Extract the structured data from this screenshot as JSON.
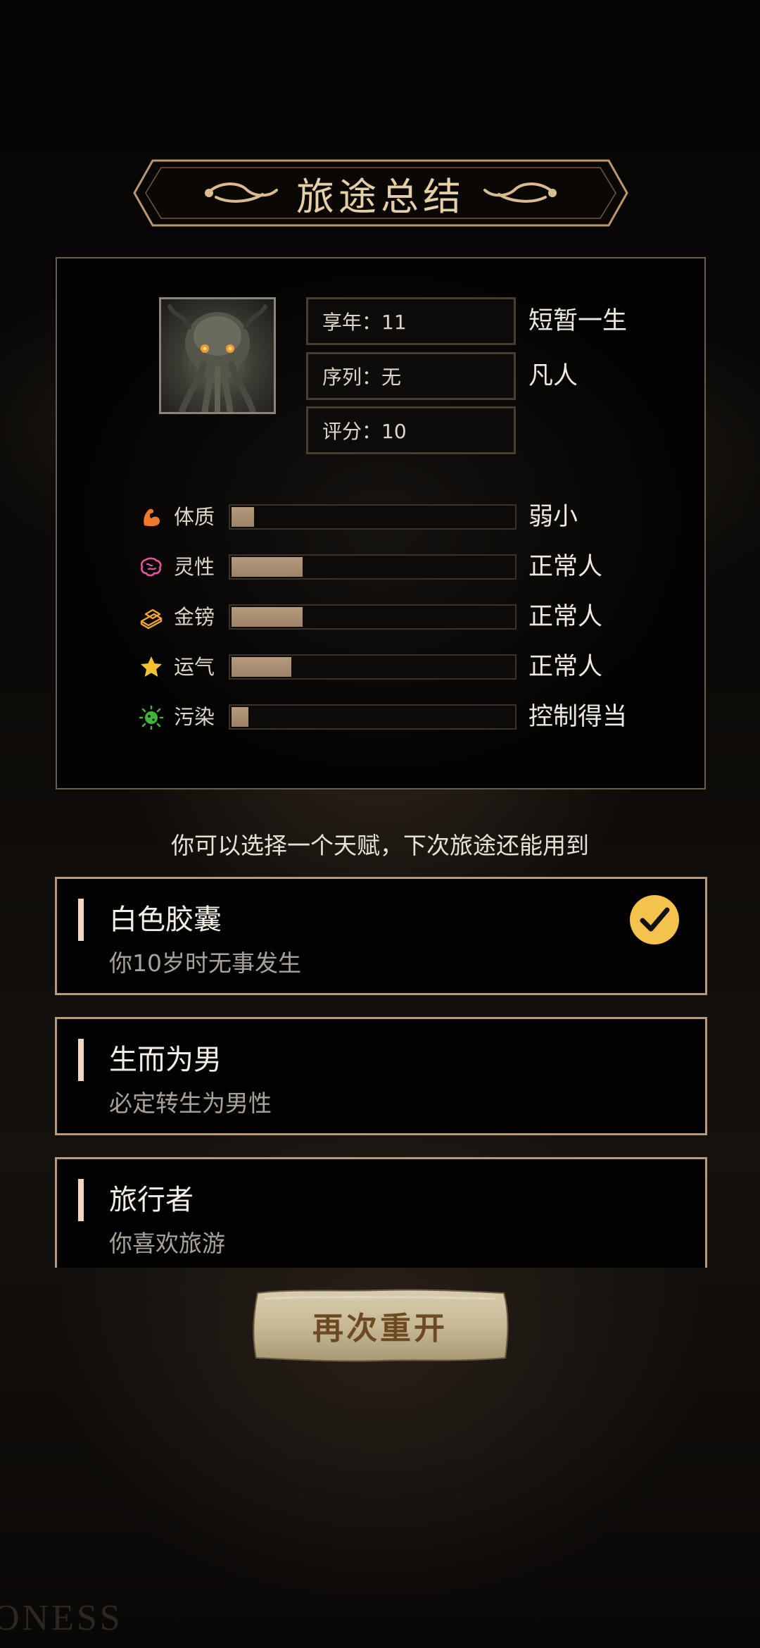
{
  "title": "旅途总结",
  "summary": {
    "age_label": "享年：11",
    "age_desc": "短暂一生",
    "sequence_label": "序列：无",
    "sequence_desc": "凡人",
    "score_label": "评分：10"
  },
  "stats": [
    {
      "key": "constitution",
      "label": "体质",
      "desc": "弱小",
      "fill": 0.08,
      "icon": "muscle-arm-icon",
      "color": "#f07a2a"
    },
    {
      "key": "spirituality",
      "label": "灵性",
      "desc": "正常人",
      "fill": 0.25,
      "icon": "brain-icon",
      "color": "#e3559c"
    },
    {
      "key": "gold",
      "label": "金镑",
      "desc": "正常人",
      "fill": 0.25,
      "icon": "gold-bars-icon",
      "color": "#f0a436"
    },
    {
      "key": "luck",
      "label": "运气",
      "desc": "正常人",
      "fill": 0.21,
      "icon": "star-icon",
      "color": "#f2c230"
    },
    {
      "key": "pollution",
      "label": "污染",
      "desc": "控制得当",
      "fill": 0.06,
      "icon": "virus-icon",
      "color": "#3fb53a"
    }
  ],
  "hint": "你可以选择一个天赋，下次旅途还能用到",
  "talents": [
    {
      "name": "白色胶囊",
      "desc": "你10岁时无事发生",
      "selected": true
    },
    {
      "name": "生而为男",
      "desc": "必定转生为男性",
      "selected": false
    },
    {
      "name": "旅行者",
      "desc": "你喜欢旅游",
      "selected": false
    }
  ],
  "restart_label": "再次重开",
  "watermark": "ONESS",
  "colors": {
    "accent_gold": "#e6cfa6",
    "bar_fill": "#b59a7d",
    "card_border": "#b99a78",
    "check_yellow": "#f4c34d"
  }
}
